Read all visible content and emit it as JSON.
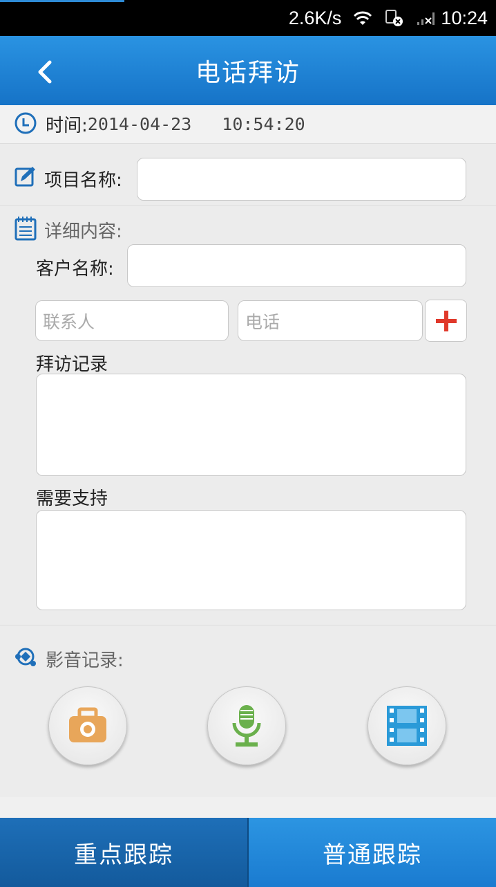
{
  "status_bar": {
    "speed": "2.6K/s",
    "time": "10:24"
  },
  "header": {
    "title": "电话拜访"
  },
  "time_row": {
    "label": "时间:",
    "date": "2014-04-23",
    "clock": "10:54:20"
  },
  "project": {
    "label": "项目名称:",
    "value": ""
  },
  "detail": {
    "label": "详细内容:",
    "customer_label": "客户名称:",
    "customer_value": "",
    "contact_placeholder": "联系人",
    "phone_placeholder": "电话",
    "visit_record_label": "拜访记录",
    "visit_record_value": "",
    "support_label": "需要支持",
    "support_value": ""
  },
  "media": {
    "label": "影音记录:",
    "buttons": [
      "camera-icon",
      "microphone-icon",
      "video-icon"
    ]
  },
  "bottom": {
    "key_track": "重点跟踪",
    "normal_track": "普通跟踪"
  },
  "colors": {
    "header_blue": "#1f84d8",
    "camera": "#e8a65a",
    "mic": "#6ab04c",
    "video": "#2a9ad8",
    "plus": "#e0392b"
  }
}
